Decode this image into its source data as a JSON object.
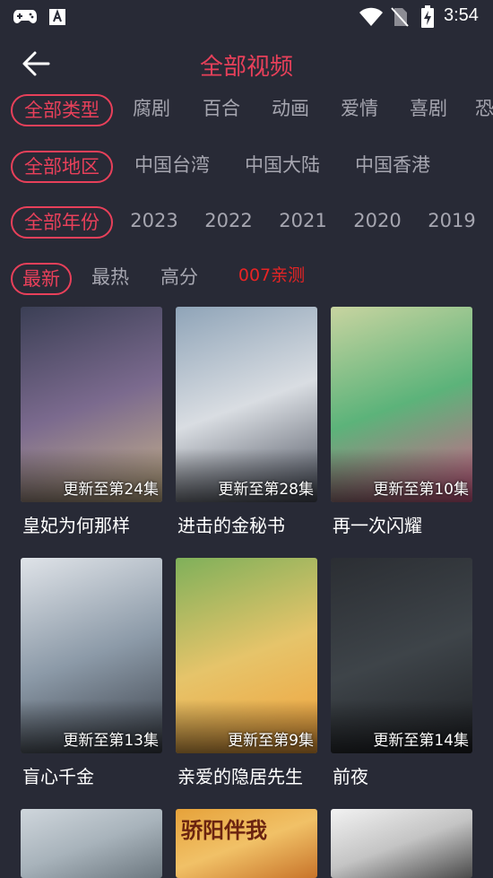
{
  "status_bar": {
    "time": "3:54",
    "icons": [
      "gamepad-icon",
      "a-icon",
      "wifi-icon",
      "no-sim-icon",
      "battery-charging-icon"
    ]
  },
  "header": {
    "title": "全部视频",
    "back_icon": "arrow-left-icon"
  },
  "filters": {
    "type": {
      "selected": "全部类型",
      "options": [
        "全部类型",
        "腐剧",
        "百合",
        "动画",
        "爱情",
        "喜剧",
        "恐"
      ]
    },
    "region": {
      "selected": "全部地区",
      "options": [
        "全部地区",
        "中国台湾",
        "中国大陆",
        "中国香港"
      ]
    },
    "year": {
      "selected": "全部年份",
      "options": [
        "全部年份",
        "2023",
        "2022",
        "2021",
        "2020",
        "2019"
      ]
    },
    "sort": {
      "selected": "最新",
      "options": [
        "最新",
        "最热",
        "高分"
      ],
      "promo": "007亲测",
      "promo_color": "#e82424"
    }
  },
  "accent_color": "#e8405a",
  "videos": [
    {
      "title": "皇妃为何那样",
      "episode": "更新至第24集",
      "colors": [
        "#3b3f55",
        "#7b6a8e",
        "#c9b48a"
      ]
    },
    {
      "title": "进击的金秘书",
      "episode": "更新至第28集",
      "colors": [
        "#8fa4b8",
        "#d9dde2",
        "#4a4f5c"
      ]
    },
    {
      "title": "再一次闪耀",
      "episode": "更新至第10集",
      "colors": [
        "#c8d4a0",
        "#5cb37a",
        "#d65c8a"
      ]
    },
    {
      "title": "盲心千金",
      "episode": "更新至第13集",
      "colors": [
        "#dfe3e8",
        "#8c9aa8",
        "#3a3f48"
      ]
    },
    {
      "title": "亲爱的隐居先生",
      "episode": "更新至第9集",
      "colors": [
        "#7fb05a",
        "#e6c46a",
        "#f2a13a"
      ]
    },
    {
      "title": "前夜",
      "episode": "更新至第14集",
      "colors": [
        "#2b2e33",
        "#3e4449",
        "#1e2024"
      ]
    },
    {
      "title": "",
      "episode": "",
      "colors": [
        "#cfd6dc",
        "#a8b3bb",
        "#6d7880"
      ]
    },
    {
      "title": "骄阳伴我",
      "episode": "",
      "colors": [
        "#e6a23a",
        "#f1c167",
        "#c8742a"
      ]
    },
    {
      "title": "",
      "episode": "",
      "colors": [
        "#f2f2f2",
        "#c4c4c4",
        "#4a4a4a"
      ]
    }
  ]
}
